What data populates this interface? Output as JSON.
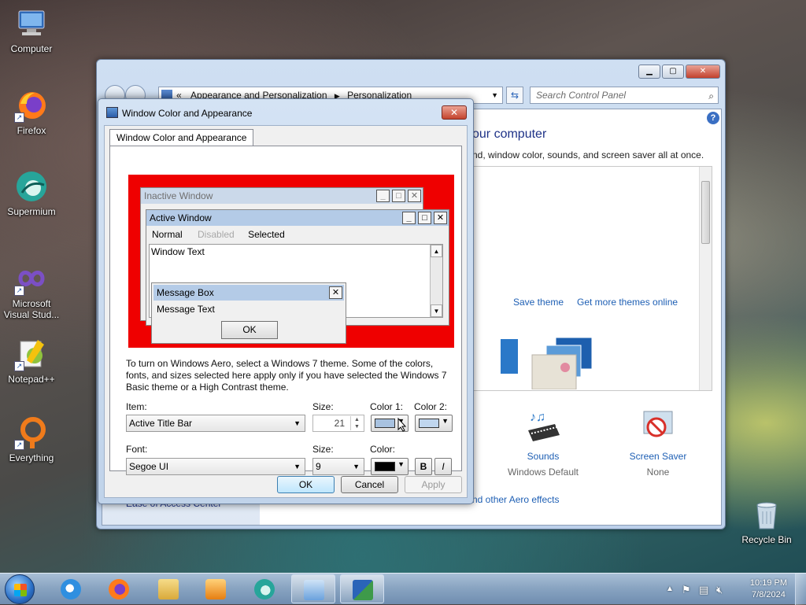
{
  "desktop": {
    "icons": [
      {
        "label": "Computer",
        "icon": "computer-icon",
        "shortcut": false,
        "color": "#4a86c8"
      },
      {
        "label": "Firefox",
        "icon": "firefox-icon",
        "shortcut": true,
        "color": "#ff7a1a"
      },
      {
        "label": "Supermium",
        "icon": "supermium-icon",
        "shortcut": false,
        "color": "#27a59a"
      },
      {
        "label": "Microsoft Visual Stud...",
        "icon": "visual-studio-icon",
        "shortcut": true,
        "color": "#7b4fc4"
      },
      {
        "label": "Notepad++",
        "icon": "notepad-plus-plus-icon",
        "shortcut": true,
        "color": "#8fc33d"
      },
      {
        "label": "Everything",
        "icon": "everything-search-icon",
        "shortcut": true,
        "color": "#f07b1b"
      },
      {
        "label": "Recycle Bin",
        "icon": "recycle-bin-icon",
        "shortcut": false,
        "color": "#9fb8cc"
      }
    ]
  },
  "control_panel": {
    "breadcrumb_sep": "«",
    "breadcrumb": [
      "Appearance and Personalization",
      "Personalization"
    ],
    "search_placeholder": "Search Control Panel",
    "title_partial": "our computer",
    "subtitle_partial": "nd, window color, sounds, and screen saver all at once.",
    "save_theme": "Save theme",
    "get_more_themes": "Get more themes online",
    "sounds_label": "Sounds",
    "sounds_value": "Windows Default",
    "screensaver_label": "Screen Saver",
    "screensaver_value": "None",
    "aero_link_partial": "nd other Aero effects",
    "ease_link_partial": "Ease of Access Center"
  },
  "dialog": {
    "title": "Window Color and Appearance",
    "tab_label": "Window Color and Appearance",
    "preview": {
      "inactive_title": "Inactive Window",
      "active_title": "Active Window",
      "menu_normal": "Normal",
      "menu_disabled": "Disabled",
      "menu_selected": "Selected",
      "window_text": "Window Text",
      "msgbox_title": "Message Box",
      "msgbox_text": "Message Text",
      "msgbox_ok": "OK",
      "desktop_color": "#ef0000",
      "active_bar_color": "#b4cbe7",
      "inactive_bar_color": "#cbd9ea"
    },
    "description": "To turn on Windows Aero, select a Windows 7 theme.  Some of the colors, fonts, and sizes selected here apply only if you have selected the Windows 7 Basic theme or a High Contrast theme.",
    "item_label": "Item:",
    "item_value": "Active Title Bar",
    "size_label": "Size:",
    "size_value": "21",
    "color1_label": "Color 1:",
    "color1_value": "#a8c2e0",
    "color2_label": "Color 2:",
    "color2_value": "#c0d6ee",
    "font_label": "Font:",
    "font_value": "Segoe UI",
    "font_size_label": "Size:",
    "font_size_value": "9",
    "font_color_label": "Color:",
    "font_color_value": "#000000",
    "bold_label": "B",
    "italic_label": "I",
    "ok_label": "OK",
    "cancel_label": "Cancel",
    "apply_label": "Apply"
  },
  "taskbar": {
    "apps": [
      {
        "name": "internet-explorer",
        "color": "#2f8fe0",
        "active": false
      },
      {
        "name": "firefox",
        "color": "#ff7a1a",
        "active": false
      },
      {
        "name": "file-explorer",
        "color": "#e8c25a",
        "active": false
      },
      {
        "name": "media-player",
        "color": "#f29a1b",
        "active": false
      },
      {
        "name": "supermium",
        "color": "#27a59a",
        "active": false
      },
      {
        "name": "control-panel",
        "color": "#6aa1dd",
        "active": true
      },
      {
        "name": "display-settings",
        "color": "#3e9a4a",
        "active": true
      }
    ],
    "time": "10:19 PM",
    "date": "7/8/2024"
  }
}
